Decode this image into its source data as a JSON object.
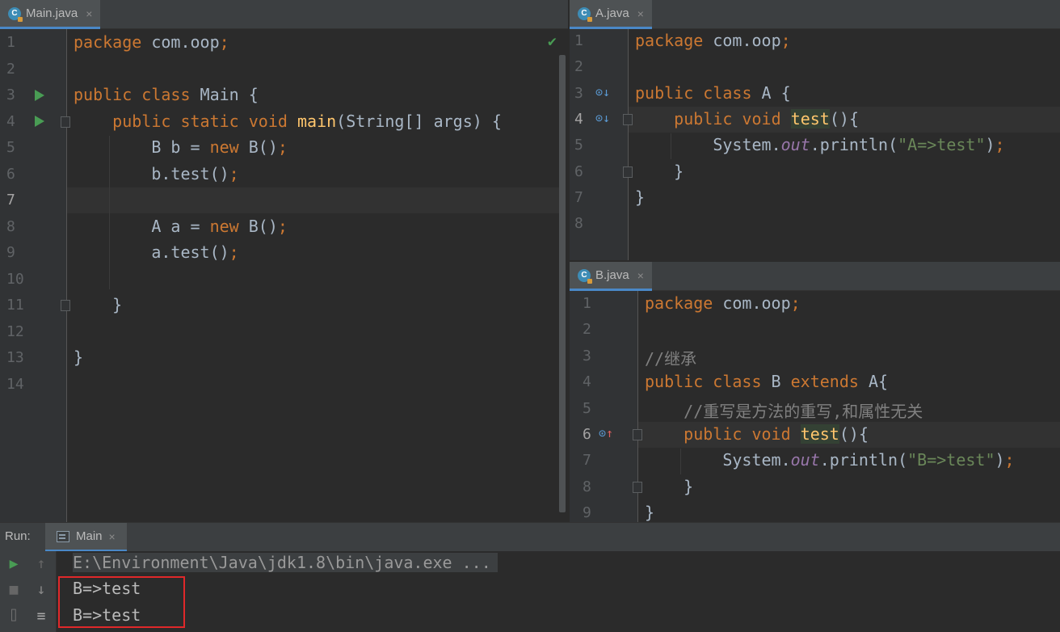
{
  "main_editor": {
    "tab": {
      "label": "Main.java",
      "icon": "java-class-icon",
      "close": "×"
    },
    "line_numbers": [
      "1",
      "2",
      "3",
      "4",
      "5",
      "6",
      "7",
      "8",
      "9",
      "10",
      "11",
      "12",
      "13",
      "14"
    ],
    "lines": [
      "package com.oop;",
      "",
      "public class Main {",
      "    public static void main(String[] args) {",
      "        B b = new B();",
      "        b.test();",
      "",
      "        A a = new B();",
      "        a.test();",
      "",
      "    }",
      "",
      "}",
      ""
    ],
    "status_icon": "✔"
  },
  "a_editor": {
    "tab": {
      "label": "A.java",
      "icon": "java-class-icon",
      "close": "×"
    },
    "line_numbers": [
      "1",
      "2",
      "3",
      "4",
      "5",
      "6",
      "7",
      "8"
    ],
    "lines": [
      "package com.oop;",
      "",
      "public class A {",
      "    public void test(){",
      "        System.out.println(\"A=>test\");",
      "    }",
      "}",
      ""
    ]
  },
  "b_editor": {
    "tab": {
      "label": "B.java",
      "icon": "java-class-icon",
      "close": "×"
    },
    "line_numbers": [
      "1",
      "2",
      "3",
      "4",
      "5",
      "6",
      "7",
      "8",
      "9"
    ],
    "lines": [
      "package com.oop;",
      "",
      "//继承",
      "public class B extends A{",
      "    //重写是方法的重写,和属性无关",
      "    public void test(){",
      "        System.out.println(\"B=>test\");",
      "    }",
      "}"
    ]
  },
  "run_panel": {
    "label": "Run:",
    "tab_label": "Main",
    "tab_close": "×",
    "command": "E:\\Environment\\Java\\jdk1.8\\bin\\java.exe ...",
    "output": [
      "B=>test",
      "B=>test"
    ]
  },
  "colors": {
    "keyword": "#cc7832",
    "method": "#ffc66d",
    "string": "#6a8759",
    "static_field": "#9876aa",
    "comment": "#808080",
    "highlight_box": "#e0282a"
  }
}
